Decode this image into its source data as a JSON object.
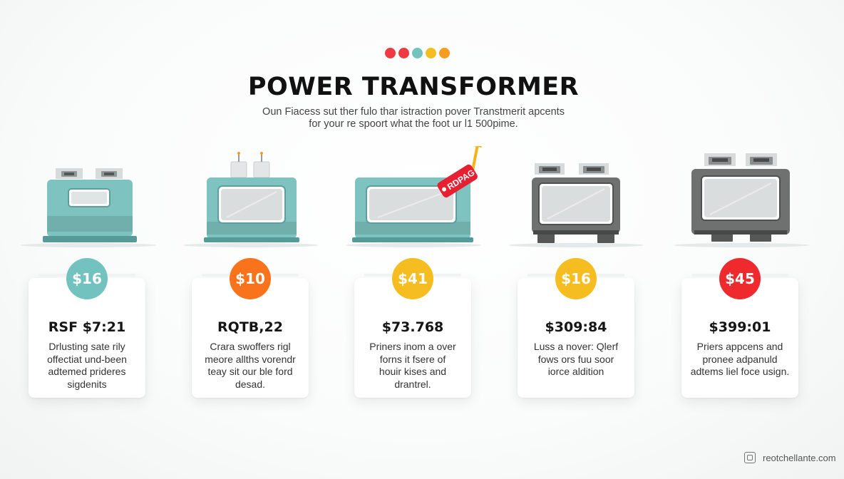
{
  "header": {
    "dots": [
      "#ee3a40",
      "#ee3a40",
      "#72c3c0",
      "#f5bd1f",
      "#f59d1f"
    ],
    "title": "POWER TRANSFORMER",
    "subtitle_line1": "Oun Fiacess sut ther fulo thar istraction pover Transtmerit apcents",
    "subtitle_line2": "for your re spoort what the foot ur l1 500pime."
  },
  "products": [
    {
      "icon": "teal-transformer-icon",
      "body_color": "#7ec3c0"
    },
    {
      "icon": "teal-transformer-bushings-icon",
      "body_color": "#7ec3c0"
    },
    {
      "icon": "teal-transformer-tag-icon",
      "body_color": "#7ec3c0",
      "tag_text": "RDPAG",
      "tag_color": "#e62030",
      "arrow_color": "#f5b21a"
    },
    {
      "icon": "gray-transformer-icon",
      "body_color": "#6f7070"
    },
    {
      "icon": "gray-transformer-large-icon",
      "body_color": "#6f7070"
    }
  ],
  "cards": [
    {
      "badge": "$16",
      "badge_color": "#72c3c0",
      "price": "RSF $7:21",
      "desc": [
        "Drlusting sate rily",
        "offectiat und-been",
        "adtemed prideres",
        "sigdenits"
      ]
    },
    {
      "badge": "$10",
      "badge_color": "#f9731c",
      "price": "RQTB,22",
      "desc": [
        "Crara swoffers rigl",
        "meore allths vorendr",
        "teay sit our ble ford",
        "desad."
      ]
    },
    {
      "badge": "$41",
      "badge_color": "#f5bd1f",
      "price": "$73.768",
      "desc": [
        "Priners inom a over",
        "forns it fsere of",
        "houir kises and",
        "drantrel."
      ]
    },
    {
      "badge": "$16",
      "badge_color": "#f5bd1f",
      "price": "$309:84",
      "desc": [
        "Luss a nover: Qlerf",
        "fows ors fuu soor",
        "iorce aldition"
      ]
    },
    {
      "badge": "$45",
      "badge_color": "#ee2a2f",
      "price": "$399:01",
      "desc": [
        "Priers appcens and",
        "pronee adpanuld",
        "adtems liel foce usign."
      ]
    }
  ],
  "watermark": {
    "text": "reotchellante.com",
    "icon": "stamp-icon"
  }
}
